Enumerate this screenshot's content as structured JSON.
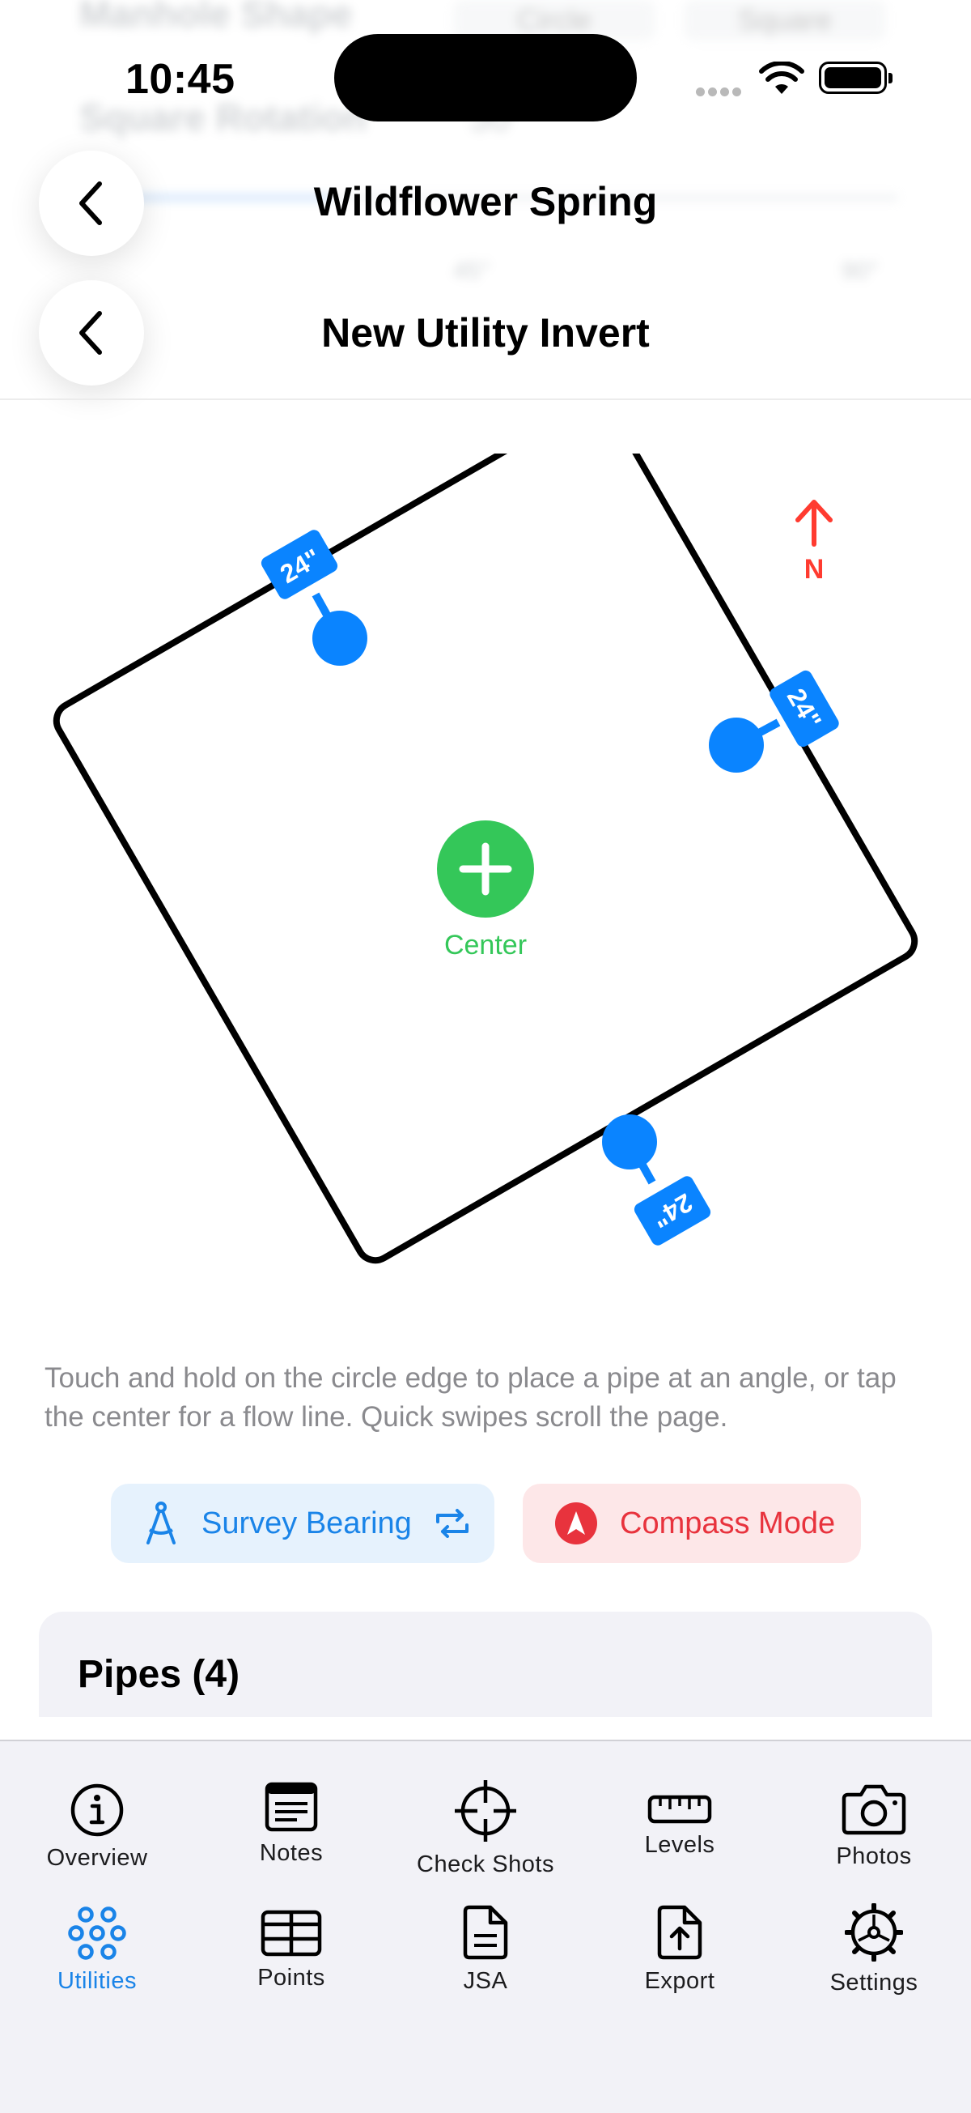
{
  "background_ghost": {
    "row1_label": "Manhole Shape",
    "row1_opt1": "Circle",
    "row1_opt2": "Square",
    "row2_label": "Square Rotation",
    "row2_value": "30",
    "tick_a": "45°",
    "tick_b": "90°"
  },
  "status_bar": {
    "time": "10:45"
  },
  "nav": {
    "parent_title": "Wildflower Spring",
    "title": "New Utility Invert"
  },
  "diagram": {
    "shape": "square",
    "rotation_deg": 30,
    "pipes": [
      {
        "size": "24\""
      },
      {
        "size": "24\""
      },
      {
        "size": "24\""
      }
    ],
    "center_label": "Center",
    "north_label": "N",
    "colors": {
      "pipe": "#0a84ff",
      "center": "#34c759",
      "north": "#ff3b30",
      "outline": "#000000"
    }
  },
  "help_text": "Touch and hold on the circle edge to place a pipe at an angle, or tap the center for a flow line. Quick swipes scroll the page.",
  "modes": {
    "survey_label": "Survey Bearing",
    "compass_label": "Compass Mode"
  },
  "pipes_section": {
    "title": "Pipes (4)"
  },
  "tabbar": {
    "items": [
      {
        "label": "Overview",
        "icon": "info-circle-icon"
      },
      {
        "label": "Notes",
        "icon": "notes-icon"
      },
      {
        "label": "Check Shots",
        "icon": "crosshair-icon"
      },
      {
        "label": "Levels",
        "icon": "ruler-icon"
      },
      {
        "label": "Photos",
        "icon": "camera-icon"
      },
      {
        "label": "Utilities",
        "icon": "utilities-circles-icon",
        "active": true
      },
      {
        "label": "Points",
        "icon": "table-grid-icon"
      },
      {
        "label": "JSA",
        "icon": "document-icon"
      },
      {
        "label": "Export",
        "icon": "export-icon"
      },
      {
        "label": "Settings",
        "icon": "gear-icon"
      }
    ],
    "active_color": "#1a84e8"
  }
}
